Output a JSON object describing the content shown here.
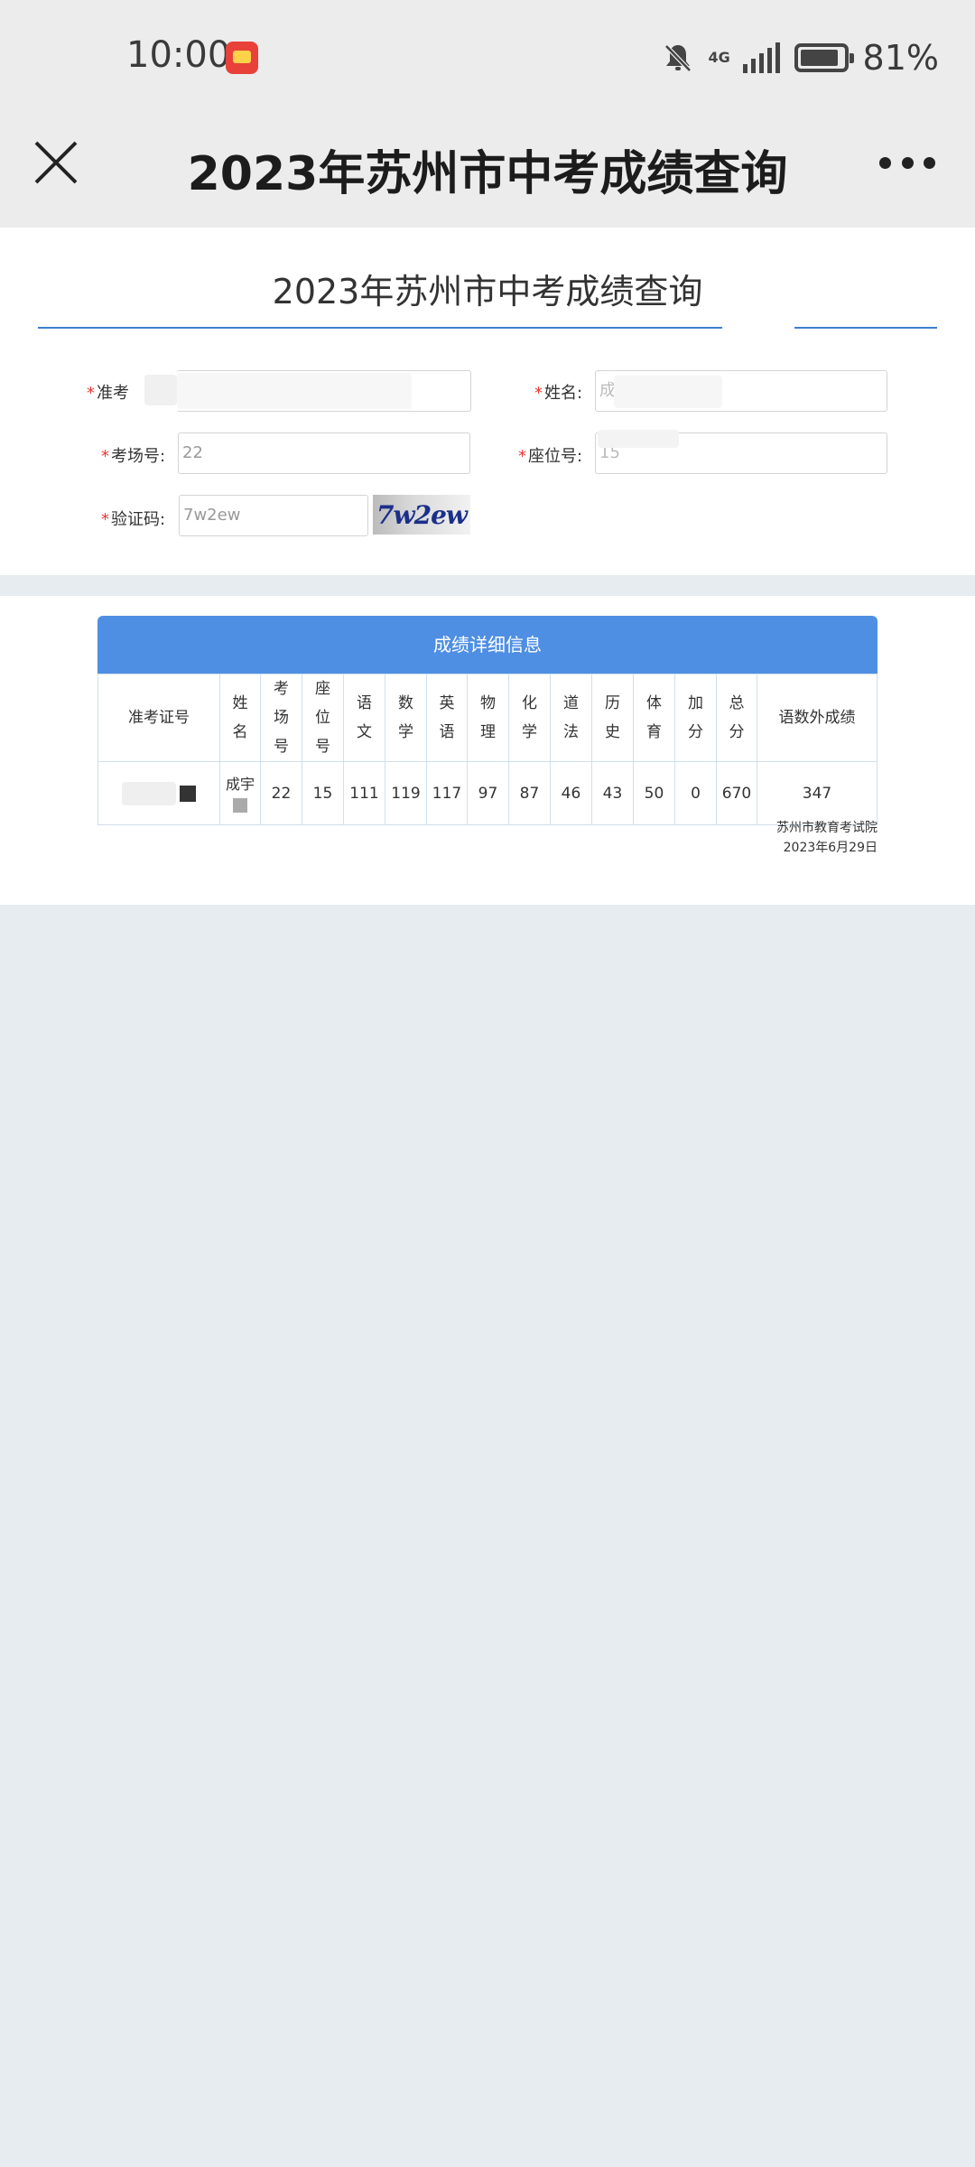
{
  "status_bar": {
    "time": "10:00",
    "network": "4G",
    "battery": "81%",
    "icons": [
      "app-notification-icon",
      "bell-muted-icon",
      "signal-icon",
      "battery-icon"
    ]
  },
  "nav": {
    "title": "2023年苏州市中考成绩查询",
    "close_icon": "close-icon",
    "more_icon": "more-icon"
  },
  "form": {
    "title": "2023年苏州市中考成绩查询",
    "ticket_label": "准考",
    "name_label": "姓名:",
    "name_value": "成",
    "room_label": "考场号:",
    "room_value": "22",
    "seat_label": "座位号:",
    "seat_value": "15",
    "captcha_label": "验证码:",
    "captcha_value": "7w2ew",
    "captcha_image_text": "7w2ew"
  },
  "results": {
    "header": "成绩详细信息",
    "columns": [
      "准考证号",
      "姓名",
      "考场号",
      "座位号",
      "语文",
      "数学",
      "英语",
      "物理",
      "化学",
      "道法",
      "历史",
      "体育",
      "加分",
      "总分",
      "语数外成绩"
    ],
    "row": {
      "name": "成宇",
      "room": "22",
      "seat": "15",
      "chinese": "111",
      "math": "119",
      "english": "117",
      "physics": "97",
      "chemistry": "87",
      "morality_law": "46",
      "history": "43",
      "pe": "50",
      "bonus": "0",
      "total": "670",
      "cme_total": "347"
    },
    "issuer": "苏州市教育考试院",
    "date": "2023年6月29日"
  },
  "colors": {
    "header_blue": "#4f8fe3",
    "underline_blue": "#3f7fcf",
    "required_red": "#e53935",
    "page_background": "#e6ecef"
  }
}
